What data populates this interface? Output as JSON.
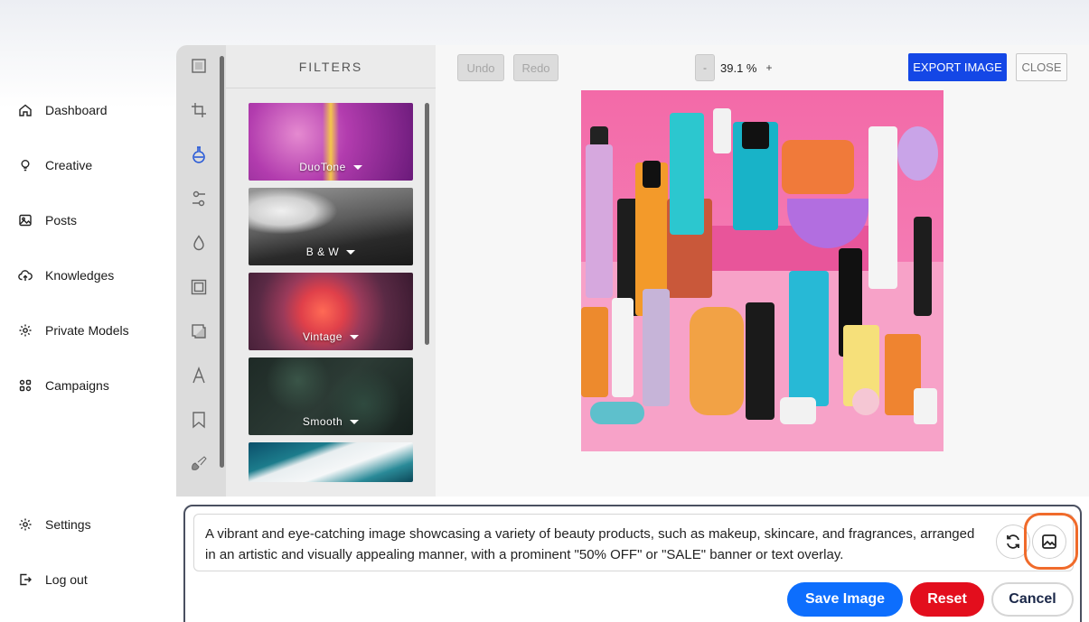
{
  "nav": {
    "items": [
      {
        "label": "Dashboard",
        "icon": "home-icon"
      },
      {
        "label": "Creative",
        "icon": "lightbulb-icon"
      },
      {
        "label": "Posts",
        "icon": "image-icon"
      },
      {
        "label": "Knowledges",
        "icon": "cloud-upload-icon"
      },
      {
        "label": "Private Models",
        "icon": "gear-icon"
      },
      {
        "label": "Campaigns",
        "icon": "grid-icon"
      }
    ],
    "bottom": [
      {
        "label": "Settings",
        "icon": "gear-icon"
      },
      {
        "label": "Log out",
        "icon": "logout-icon"
      }
    ]
  },
  "editor": {
    "filters_title": "FILTERS",
    "filters": [
      {
        "label": "DuoTone"
      },
      {
        "label": "B & W"
      },
      {
        "label": "Vintage"
      },
      {
        "label": "Smooth"
      }
    ],
    "toolbar": {
      "undo": "Undo",
      "redo": "Redo",
      "zoom_minus": "-",
      "zoom_value": "39.1 %",
      "zoom_plus": "+",
      "export": "EXPORT IMAGE",
      "close": "CLOSE"
    }
  },
  "prompt": {
    "text": "A vibrant and eye-catching image showcasing a variety of beauty products, such as makeup, skincare, and fragrances, arranged in an artistic and visually appealing manner, with a prominent \"50% OFF\" or \"SALE\" banner or text overlay.",
    "actions": {
      "save": "Save Image",
      "reset": "Reset",
      "cancel": "Cancel"
    }
  },
  "colors": {
    "accent_blue": "#1447e6",
    "save_blue": "#0d6efd",
    "reset_red": "#e30e1d",
    "highlight_orange": "#f06b2b"
  }
}
